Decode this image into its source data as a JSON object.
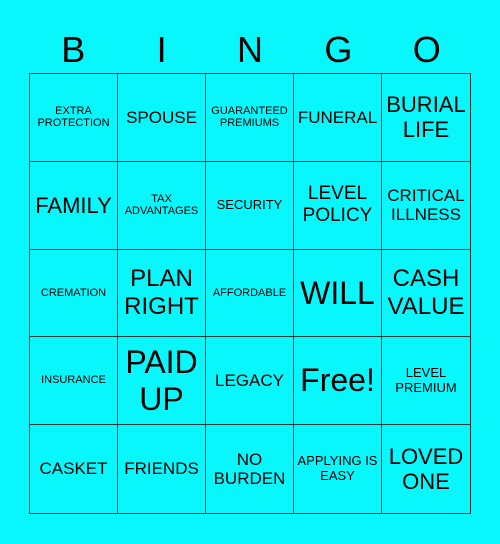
{
  "header": [
    "B",
    "I",
    "N",
    "G",
    "O"
  ],
  "colors": {
    "background": "#07f7fc",
    "grid_line": "#1a3a3a",
    "text": "#000000"
  },
  "cells": [
    {
      "text": "EXTRA PROTECTION",
      "size": "s-xs"
    },
    {
      "text": "SPOUSE",
      "size": "s-md"
    },
    {
      "text": "GUARANTEED PREMIUMS",
      "size": "s-xs"
    },
    {
      "text": "FUNERAL",
      "size": "s-md"
    },
    {
      "text": "BURIAL LIFE",
      "size": "s-xl"
    },
    {
      "text": "FAMILY",
      "size": "s-xl"
    },
    {
      "text": "TAX ADVANTAGES",
      "size": "s-xs"
    },
    {
      "text": "SECURITY",
      "size": "s-sm"
    },
    {
      "text": "LEVEL POLICY",
      "size": "s-lg"
    },
    {
      "text": "CRITICAL ILLNESS",
      "size": "s-md"
    },
    {
      "text": "CREMATION",
      "size": "s-xs"
    },
    {
      "text": "PLAN RIGHT",
      "size": "s-xxl"
    },
    {
      "text": "AFFORDABLE",
      "size": "s-xs"
    },
    {
      "text": "WILL",
      "size": "s-huge"
    },
    {
      "text": "CASH VALUE",
      "size": "s-xxl"
    },
    {
      "text": "INSURANCE",
      "size": "s-xs"
    },
    {
      "text": "PAID UP",
      "size": "s-huge"
    },
    {
      "text": "LEGACY",
      "size": "s-md"
    },
    {
      "text": "Free!",
      "size": "s-huge"
    },
    {
      "text": "LEVEL PREMIUM",
      "size": "s-sm"
    },
    {
      "text": "CASKET",
      "size": "s-md"
    },
    {
      "text": "FRIENDS",
      "size": "s-md"
    },
    {
      "text": "NO BURDEN",
      "size": "s-md"
    },
    {
      "text": "APPLYING IS EASY",
      "size": "s-sm"
    },
    {
      "text": "LOVED ONE",
      "size": "s-xl"
    }
  ]
}
